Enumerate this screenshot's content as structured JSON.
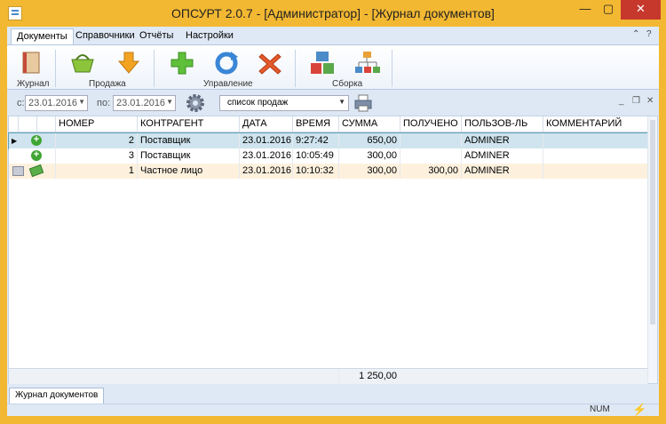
{
  "window": {
    "title": "ОПСУРТ 2.0.7 - [Администратор] - [Журнал документов]"
  },
  "menu": {
    "tabs": [
      {
        "label": "Документы",
        "active": true
      },
      {
        "label": "Справочники"
      },
      {
        "label": "Отчёты"
      },
      {
        "label": "Настройки"
      }
    ]
  },
  "ribbon": {
    "groups": [
      {
        "label": "Журнал",
        "buttons": [
          "journal-book-icon"
        ]
      },
      {
        "label": "Продажа",
        "buttons": [
          "basket-icon",
          "arrow-down-icon"
        ]
      },
      {
        "label": "Управление",
        "buttons": [
          "plus-icon",
          "refresh-icon",
          "delete-icon"
        ]
      },
      {
        "label": "Сборка",
        "buttons": [
          "assembly-blocks-icon",
          "hierarchy-icon"
        ]
      }
    ]
  },
  "filter": {
    "from_label": "с:",
    "from_value": "23.01.2016",
    "to_label": "по:",
    "to_value": "23.01.2016",
    "doc_type": "список продаж"
  },
  "table": {
    "columns": [
      "НОМЕР",
      "КОНТРАГЕНТ",
      "ДАТА",
      "ВРЕМЯ",
      "СУММА",
      "ПОЛУЧЕНО",
      "ПОЛЬЗОВ-ЛЬ",
      "КОММЕНТАРИЙ"
    ],
    "rows": [
      {
        "number": "2",
        "counterparty": "Поставщик",
        "date": "23.01.2016",
        "time": "9:27:42",
        "sum": "650,00",
        "received": "",
        "user": "ADMINER",
        "comment": ""
      },
      {
        "number": "3",
        "counterparty": "Поставщик",
        "date": "23.01.2016",
        "time": "10:05:49",
        "sum": "300,00",
        "received": "",
        "user": "ADMINER",
        "comment": ""
      },
      {
        "number": "1",
        "counterparty": "Частное лицо",
        "date": "23.01.2016",
        "time": "10:10:32",
        "sum": "300,00",
        "received": "300,00",
        "user": "ADMINER",
        "comment": ""
      }
    ],
    "total_sum": "1 250,00"
  },
  "doc_tabs": [
    "Журнал документов"
  ],
  "status": {
    "num": "NUM"
  },
  "colors": {
    "titlebar": "#f3b832",
    "accent": "#dfe9f5",
    "selected_row": "#cfe4ee",
    "highlight_row": "#fdf1de"
  }
}
